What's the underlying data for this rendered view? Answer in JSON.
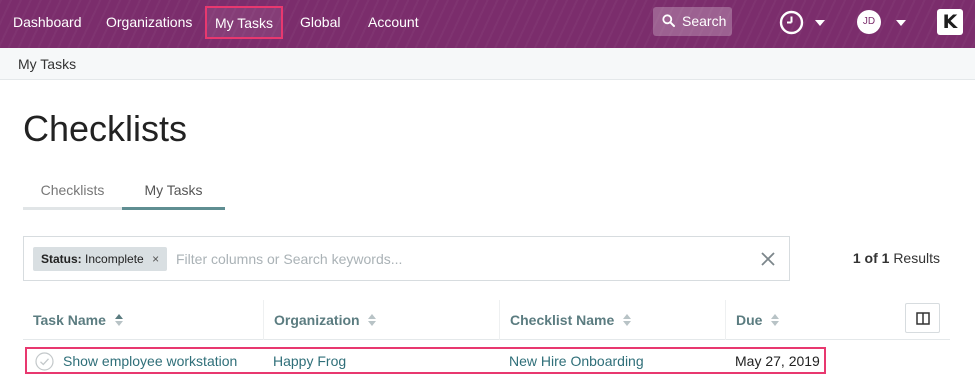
{
  "nav": {
    "items": [
      "Dashboard",
      "Organizations",
      "My Tasks",
      "Global",
      "Account"
    ],
    "search_label": "Search",
    "avatar_initials": "JD",
    "logo_text": "K"
  },
  "breadcrumb": "My Tasks",
  "page": {
    "title": "Checklists"
  },
  "tabs": [
    {
      "label": "Checklists",
      "active": false
    },
    {
      "label": "My Tasks",
      "active": true
    }
  ],
  "filter": {
    "chip_key": "Status:",
    "chip_value": "Incomplete",
    "chip_remove": "×",
    "placeholder": "Filter columns or Search keywords...",
    "value": ""
  },
  "results": {
    "current": "1",
    "of_label": "of",
    "total": "1",
    "label": "Results"
  },
  "table": {
    "columns": [
      "Task Name",
      "Organization",
      "Checklist Name",
      "Due"
    ],
    "rows": [
      {
        "task": "Show employee workstation",
        "organization": "Happy Frog",
        "checklist": "New Hire Onboarding",
        "due": "May 27, 2019"
      }
    ]
  },
  "colors": {
    "nav_bg": "#7b2d6c",
    "highlight": "#e8386f",
    "link": "#2f6f79",
    "header_text": "#5b7c80",
    "tab_active": "#5f8e92"
  },
  "icons": [
    "search-icon",
    "clock-icon",
    "chevron-down-icon",
    "close-icon",
    "sort-icon",
    "columns-icon",
    "check-circle-icon"
  ]
}
